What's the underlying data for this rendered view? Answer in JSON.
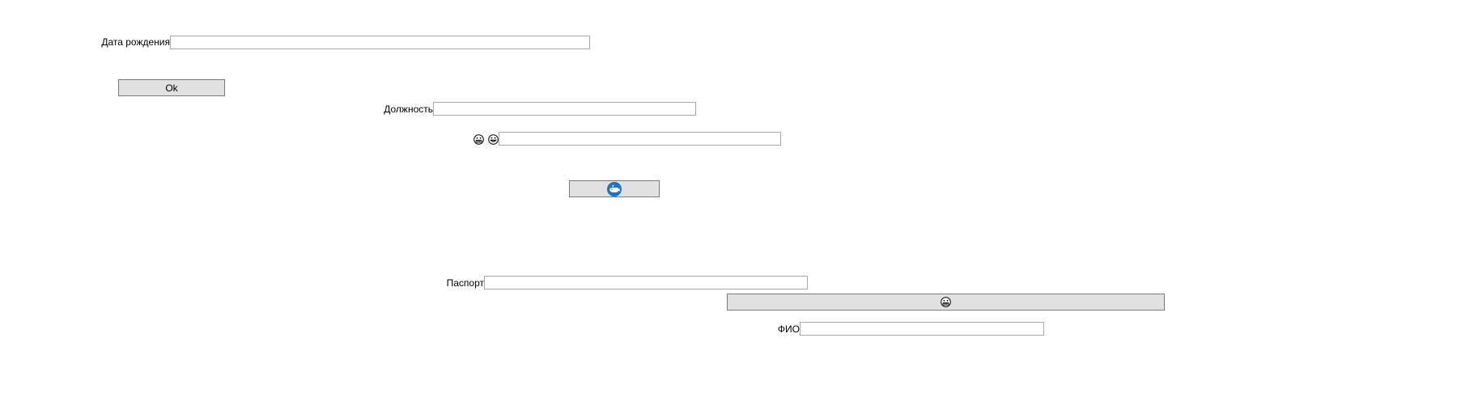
{
  "form": {
    "birth_date": {
      "label": "Дата рождения",
      "value": ""
    },
    "ok_button": {
      "label": "Ok"
    },
    "position": {
      "label": "Должность",
      "value": ""
    },
    "emoji_field": {
      "value": "",
      "icons": [
        "grimacing-face-icon",
        "grinning-face-icon"
      ]
    },
    "whale_button": {
      "icon": "whale-icon"
    },
    "passport": {
      "label": "Паспорт",
      "value": ""
    },
    "grimace_button": {
      "icon": "grimacing-face-icon"
    },
    "full_name": {
      "label": "ФИО",
      "value": ""
    }
  },
  "colors": {
    "button_bg": "#e1e1e1",
    "button_border": "#7a7a7a",
    "input_border": "#a8a8a8",
    "icon_blue": "#1a73c9"
  }
}
